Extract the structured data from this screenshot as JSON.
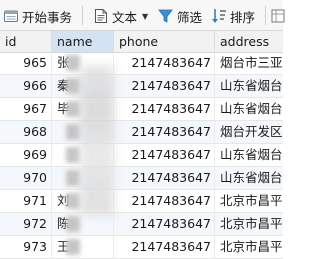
{
  "toolbar": {
    "begin_transaction": "开始事务",
    "text": "文本",
    "filter": "筛选",
    "sort": "排序"
  },
  "columns": [
    "id",
    "name",
    "phone",
    "address"
  ],
  "rows": [
    {
      "id": "965",
      "name": "张",
      "phone": "2147483647",
      "address": "烟台市三亚路"
    },
    {
      "id": "966",
      "name": "秦",
      "phone": "2147483647",
      "address": "山东省烟台市"
    },
    {
      "id": "967",
      "name": "毕",
      "phone": "2147483647",
      "address": "山东省烟台市"
    },
    {
      "id": "968",
      "name": "",
      "phone": "2147483647",
      "address": "烟台开发区"
    },
    {
      "id": "969",
      "name": "",
      "phone": "2147483647",
      "address": "山东省烟台市"
    },
    {
      "id": "970",
      "name": "",
      "phone": "2147483647",
      "address": "山东省烟台市"
    },
    {
      "id": "971",
      "name": "刘",
      "phone": "2147483647",
      "address": "北京市昌平区"
    },
    {
      "id": "972",
      "name": "陈",
      "phone": "2147483647",
      "address": "北京市昌平区"
    },
    {
      "id": "973",
      "name": "王",
      "phone": "2147483647",
      "address": "北京市昌平区"
    }
  ]
}
